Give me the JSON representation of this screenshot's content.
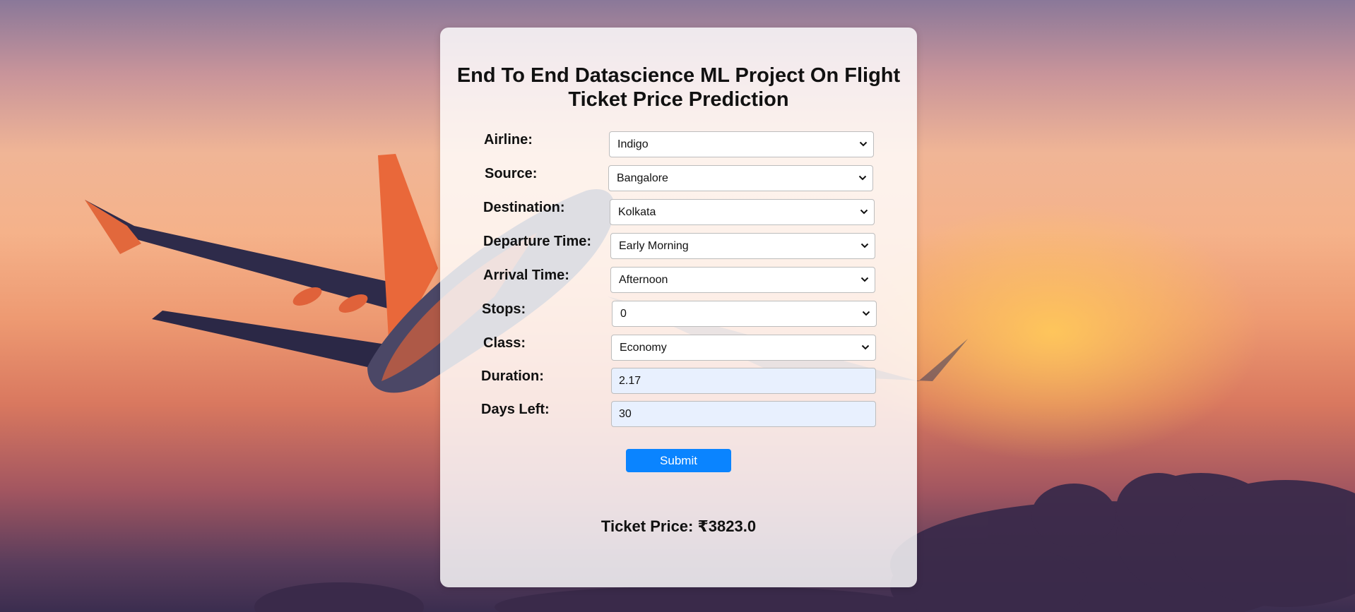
{
  "page": {
    "title": "End To End Datascience ML Project On Flight Ticket Price Prediction"
  },
  "form": {
    "airline": {
      "label": "Airline:",
      "value": "Indigo"
    },
    "source": {
      "label": "Source:",
      "value": "Bangalore"
    },
    "destination": {
      "label": "Destination:",
      "value": "Kolkata"
    },
    "departure_time": {
      "label": "Departure Time:",
      "value": "Early Morning"
    },
    "arrival_time": {
      "label": "Arrival Time:",
      "value": "Afternoon"
    },
    "stops": {
      "label": "Stops:",
      "value": "0"
    },
    "class": {
      "label": "Class:",
      "value": "Economy"
    },
    "duration": {
      "label": "Duration:",
      "value": "2.17"
    },
    "days_left": {
      "label": "Days Left:",
      "value": "30"
    },
    "submit_label": "Submit"
  },
  "result": {
    "text": "Ticket Price: ₹3823.0"
  },
  "colors": {
    "accent": "#0a84ff",
    "input_autofill": "#e8f0fe"
  },
  "icons": {
    "dropdown": "chevron-down-icon"
  }
}
